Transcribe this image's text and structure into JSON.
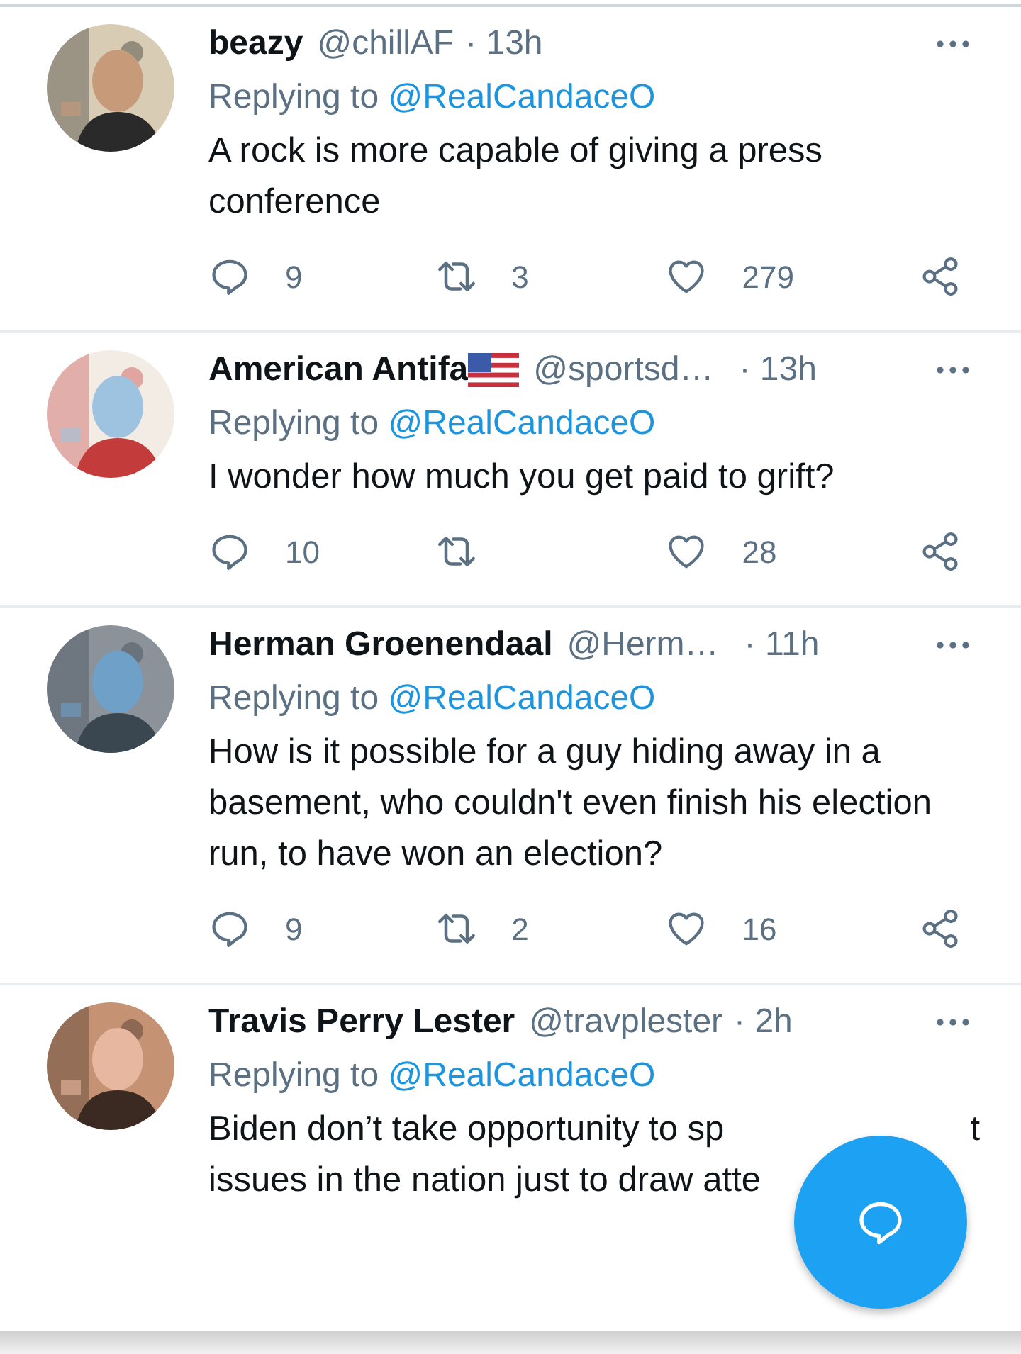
{
  "tweets": [
    {
      "kind": "full",
      "name": "beazy",
      "handle": "@chillAF",
      "time": "· 13h",
      "replying_label": "Replying to",
      "replying_to": "@RealCandaceO",
      "text": [
        "A rock is more capable of giving a press conference"
      ],
      "actions": [
        {
          "kind": "reply",
          "count": "9"
        },
        {
          "kind": "retweet",
          "count": "3"
        },
        {
          "kind": "like",
          "count": "279"
        },
        {
          "kind": "share"
        }
      ]
    },
    {
      "kind": "full",
      "name": "American Antifa",
      "handle": "@sportsd…",
      "time": "· 13h",
      "flag_badge": true,
      "replying_label": "Replying to",
      "replying_to": "@RealCandaceO",
      "text": [
        "I wonder how much you get paid to grift?"
      ],
      "actions": [
        {
          "kind": "reply",
          "count": "10"
        },
        {
          "kind": "retweet"
        },
        {
          "kind": "like",
          "count": "28"
        },
        {
          "kind": "share"
        }
      ]
    },
    {
      "kind": "full",
      "name": "Herman Groenendaal",
      "handle": "@Herm…",
      "time": "· 11h",
      "replying_label": "Replying to",
      "replying_to": "@RealCandaceO",
      "text": [
        "How is it possible for a guy hiding away in a basement, who couldn't even finish his election run, to have won an election?"
      ],
      "actions": [
        {
          "kind": "reply",
          "count": "9"
        },
        {
          "kind": "retweet",
          "count": "2"
        },
        {
          "kind": "like",
          "count": "16"
        },
        {
          "kind": "share"
        }
      ]
    },
    {
      "kind": "covered",
      "name": "Travis Perry Lester",
      "handle": "@travplester",
      "time": "· 2h",
      "replying_label": "Replying to",
      "replying_to": "@RealCandaceO",
      "text": [
        "Biden don’t take opportunity to sp",
        "t",
        "issues in the nation just to draw atte"
      ]
    }
  ],
  "compose_button": true
}
